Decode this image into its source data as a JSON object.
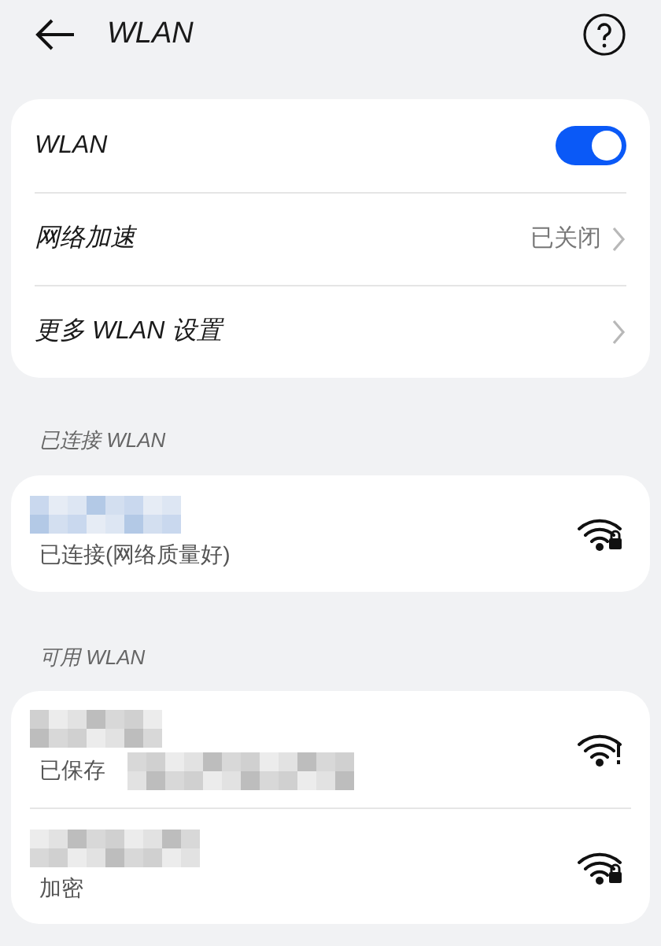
{
  "header": {
    "title": "WLAN"
  },
  "settings": [
    {
      "kind": "toggle",
      "label": "WLAN",
      "on": true
    },
    {
      "kind": "link",
      "label": "网络加速",
      "value": "已关闭"
    },
    {
      "kind": "link",
      "label": "更多 WLAN 设置"
    }
  ],
  "connected": {
    "heading": "已连接 WLAN",
    "networks": [
      {
        "status": "已连接(网络质量好)",
        "kind": "locked"
      }
    ]
  },
  "available": {
    "heading": "可用 WLAN",
    "networks": [
      {
        "status": "已保存",
        "kind": "warning"
      },
      {
        "status": "加密",
        "kind": "locked"
      }
    ]
  }
}
